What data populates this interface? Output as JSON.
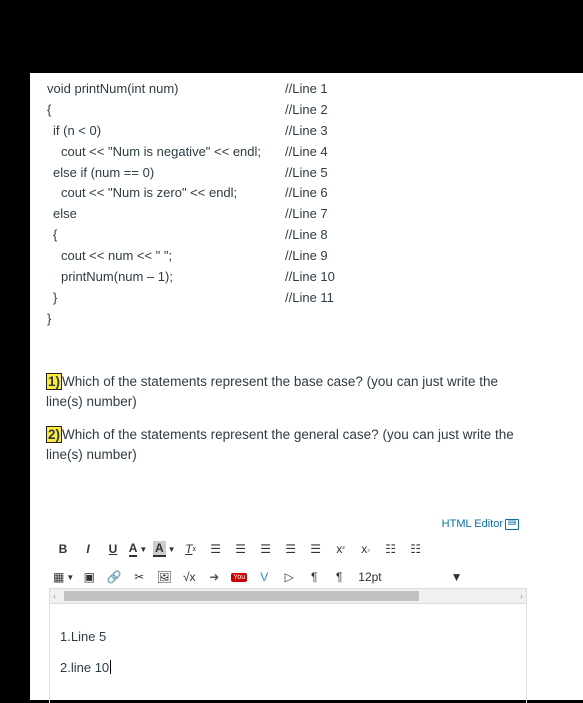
{
  "code": {
    "lines": [
      {
        "stmt": "void printNum(int num)",
        "indent": 0,
        "comment": "//Line 1"
      },
      {
        "stmt": "{",
        "indent": 0,
        "comment": "//Line 2"
      },
      {
        "stmt": "if (n < 0)",
        "indent": 1,
        "comment": "//Line 3"
      },
      {
        "stmt": "cout << \"Num is negative\" << endl;",
        "indent": 2,
        "comment": "//Line 4"
      },
      {
        "stmt": "else if (num == 0)",
        "indent": 1,
        "comment": "//Line 5"
      },
      {
        "stmt": "cout << \"Num is zero\" << endl;",
        "indent": 2,
        "comment": "//Line 6"
      },
      {
        "stmt": "else",
        "indent": 1,
        "comment": "//Line 7"
      },
      {
        "stmt": "{",
        "indent": 1,
        "comment": "//Line 8"
      },
      {
        "stmt": "cout << num << \" \";",
        "indent": 2,
        "comment": "//Line 9"
      },
      {
        "stmt": "printNum(num – 1);",
        "indent": 2,
        "comment": "//Line 10"
      },
      {
        "stmt": "}",
        "indent": 1,
        "comment": "//Line 11"
      },
      {
        "stmt": "}",
        "indent": 0,
        "comment": ""
      }
    ]
  },
  "questions": [
    {
      "number": "1)",
      "text": "Which of the statements represent the base case? (you can just write the line(s) number)"
    },
    {
      "number": "2)",
      "text": "Which of the statements represent the general case? (you can just write the line(s) number)"
    }
  ],
  "editor": {
    "html_editor_label": "HTML Editor",
    "font_size": "12pt",
    "content": [
      "1.Line 5",
      "2.line 10"
    ]
  }
}
